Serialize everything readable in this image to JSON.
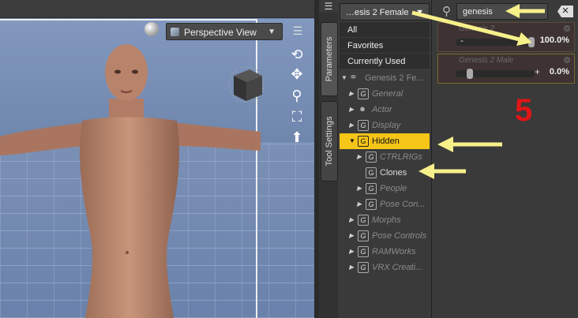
{
  "viewport": {
    "view_label": "Perspective View",
    "tools": [
      "orbit-icon",
      "move-icon",
      "zoom-icon",
      "frame-icon",
      "home-icon"
    ]
  },
  "side_tabs": {
    "parameters": "Parameters",
    "tool_settings": "Tool Settings"
  },
  "tree": {
    "product_select": "…esis 2 Female",
    "all": "All",
    "favorites": "Favorites",
    "currently_used": "Currently Used",
    "root": "Genesis 2 Fe...",
    "items": [
      {
        "label": "General",
        "state": "dim",
        "indent": 1,
        "expandable": true
      },
      {
        "label": "Actor",
        "state": "dim",
        "indent": 1,
        "expandable": true
      },
      {
        "label": "Display",
        "state": "dim",
        "indent": 1,
        "expandable": true
      },
      {
        "label": "Hidden",
        "state": "highlight",
        "indent": 1,
        "expandable": true
      },
      {
        "label": "CTRLRIGs",
        "state": "dim",
        "indent": 2,
        "expandable": true
      },
      {
        "label": "Clones",
        "state": "norm",
        "indent": 2,
        "expandable": false
      },
      {
        "label": "People",
        "state": "dim",
        "indent": 2,
        "expandable": true
      },
      {
        "label": "Pose Con...",
        "state": "dim",
        "indent": 2,
        "expandable": true
      },
      {
        "label": "Morphs",
        "state": "dim",
        "indent": 1,
        "expandable": true
      },
      {
        "label": "Pose Controls",
        "state": "dim",
        "indent": 1,
        "expandable": true
      },
      {
        "label": "RAMWorks",
        "state": "dim",
        "indent": 1,
        "expandable": true
      },
      {
        "label": "VRX Creati...",
        "state": "dim",
        "indent": 1,
        "expandable": true
      }
    ]
  },
  "search": {
    "value": "genesis"
  },
  "params": [
    {
      "name": "Genesis 2",
      "value": "100.0%",
      "fraction": 1.0
    },
    {
      "name": "Genesis 2 Male",
      "value": "0.0%",
      "fraction": 0.0
    }
  ],
  "annotation": {
    "step": "5",
    "arrow_color": "#f7f08a",
    "step_color": "#e01515"
  }
}
